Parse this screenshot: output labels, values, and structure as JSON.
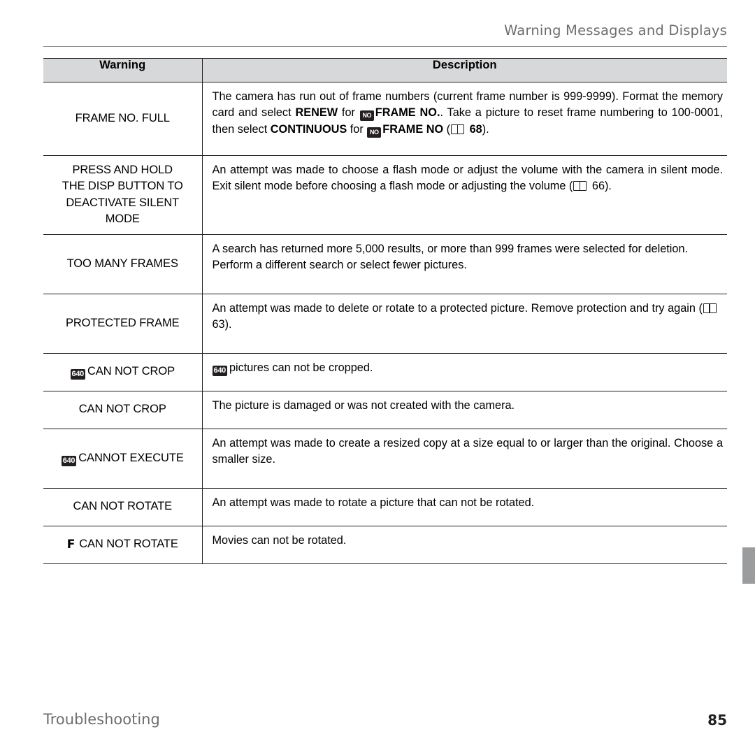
{
  "header": {
    "title": "Warning Messages and Displays"
  },
  "table": {
    "columns": [
      "Warning",
      "Description"
    ],
    "rows": [
      {
        "warning_lines": [
          "FRAME NO. FULL"
        ],
        "warning_icon": "",
        "description_html": "The camera has run out of frame numbers (current frame number is 999-9999).  Format the memory card and select <b>RENEW</b> for <i data-name=\"frame-no-icon\"></i> <b>FRAME NO.</b>.  Take a picture to reset frame numbering to 100-0001, then select <b>CONTINUOUS</b> for <i data-name=\"frame-no-icon\"></i> <b>FRAME NO</b> (<i data-name=\"book-icon\"></i> <b>68</b>).",
        "description_plain": "The camera has run out of frame numbers (current frame number is 999-9999).  Format the memory card and select RENEW for FRAME NO.. Take a picture to reset frame numbering to 100-0001, then select CONTINUOUS for FRAME NO (68)."
      },
      {
        "warning_lines": [
          "PRESS AND HOLD",
          "THE DISP BUTTON TO",
          "DEACTIVATE SILENT MODE"
        ],
        "warning_icon": "",
        "description_plain": "An attempt was made to choose a flash mode or adjust the volume with the camera in silent mode.  Exit silent mode before choosing a flash mode or adjusting the volume (66)."
      },
      {
        "warning_lines": [
          "TOO MANY FRAMES"
        ],
        "warning_icon": "",
        "description_plain": "A search has returned more 5,000 results, or more than 999 frames were selected for deletion.  Perform a different search or select fewer pictures."
      },
      {
        "warning_lines": [
          "PROTECTED FRAME"
        ],
        "warning_icon": "",
        "description_plain": "An attempt was made to delete or rotate to a protected picture.  Remove protection and try again (63)."
      },
      {
        "warning_lines": [
          "CAN NOT CROP"
        ],
        "warning_icon": "640",
        "description_plain": "pictures can not be cropped."
      },
      {
        "warning_lines": [
          "CAN NOT CROP"
        ],
        "warning_icon": "",
        "description_plain": "The picture is damaged or was not created with the camera."
      },
      {
        "warning_lines": [
          "CANNOT EXECUTE"
        ],
        "warning_icon": "640",
        "description_plain": "An attempt was made to create a resized copy at a size equal to or larger than the original.  Choose a smaller size."
      },
      {
        "warning_lines": [
          "CAN NOT ROTATE"
        ],
        "warning_icon": "",
        "description_plain": "An attempt was made to rotate a picture that can not be rotated."
      },
      {
        "warning_lines": [
          "CAN NOT ROTATE"
        ],
        "warning_icon": "film",
        "description_plain": "Movies can not be rotated."
      }
    ]
  },
  "cells": {
    "r1_warn": "FRAME NO. FULL",
    "r1_d_a": "The camera has run out of frame numbers (current frame number is 999-9999).  Format the memory card and select ",
    "r1_d_renew": "RENEW",
    "r1_d_b": " for ",
    "r1_d_frameno1": "FRAME NO.",
    "r1_d_c": ".  Take a picture to reset frame numbering to 100-0001, then select ",
    "r1_d_cont": "CONTINUOUS",
    "r1_d_d": " for ",
    "r1_d_frameno2": "FRAME NO",
    "r1_d_page": "68",
    "r2_warn_1": "PRESS AND HOLD",
    "r2_warn_2": "THE DISP BUTTON TO",
    "r2_warn_3": "DEACTIVATE SILENT MODE",
    "r2_d_a": "An attempt was made to choose a flash mode or adjust the volume with the camera in silent mode.  Exit silent mode before choosing a flash mode or adjusting the volume (",
    "r2_d_page": "66",
    "r2_d_b": ").",
    "r3_warn": "TOO MANY FRAMES",
    "r3_d": "A search has returned more 5,000 results, or more than 999 frames were selected for deletion.  Perform a different search or select fewer pictures.",
    "r4_warn": "PROTECTED FRAME",
    "r4_d_a": "An attempt was made to delete or rotate to a protected picture.  Remove protection and try again (",
    "r4_d_page": "63",
    "r4_d_b": ").",
    "r5_badge": "640",
    "r5_warn": "CAN NOT CROP",
    "r5_d": "pictures can not be cropped.",
    "r6_warn": "CAN NOT CROP",
    "r6_d": "The picture is damaged or was not created with the camera.",
    "r7_badge": "640",
    "r7_warn": "CANNOT EXECUTE",
    "r7_d": "An attempt was made to create a resized copy at a size equal to or larger than the original.  Choose a smaller size.",
    "r8_warn": "CAN NOT ROTATE",
    "r8_d": "An attempt was made to rotate a picture that can not be rotated.",
    "r9_icon": "F",
    "r9_warn": "CAN NOT ROTATE",
    "r9_d": "Movies can not be rotated."
  },
  "icons": {
    "frame_no_badge": "NO",
    "book_page_ref": "book-icon",
    "size_badge_640": "640",
    "movie_film": "F"
  },
  "footer": {
    "chapter": "Troubleshooting",
    "page_number": "85"
  },
  "colors": {
    "header_text": "#6d6e70",
    "table_head_bg": "#d7d8d9",
    "rule": "#231f20",
    "side_tab": "#9a9c9e"
  }
}
